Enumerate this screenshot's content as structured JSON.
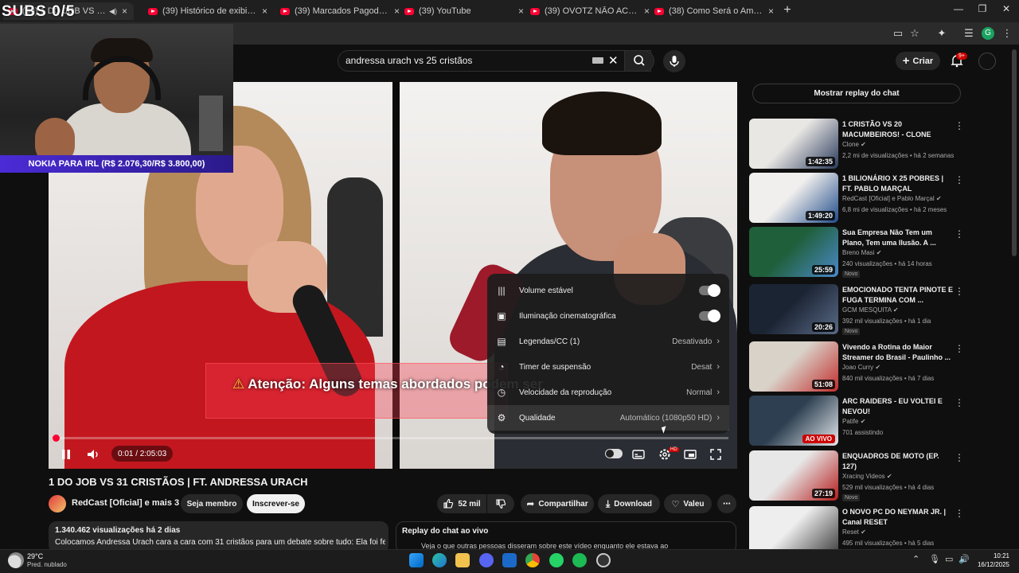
{
  "browser": {
    "tabs": [
      {
        "title": "(39) 1 DO JOB VS 31 CRISTÃ",
        "active": true
      },
      {
        "title": "(39) Histórico de exibição - You"
      },
      {
        "title": "(39) Marcados Pagode Gospel |"
      },
      {
        "title": "(39) YouTube"
      },
      {
        "title": "(39) OVOTZ NÃO ACREDITOU C"
      },
      {
        "title": "(38) Como Será o Amanhã | Ma"
      }
    ],
    "new_tab": "+",
    "close": "×",
    "minimize": "—",
    "maximize": "❐",
    "window_close": "✕"
  },
  "stream_overlay": {
    "subs_counter": "SUBS  0/5",
    "banner": "NOKIA PARA IRL (R$ 2.076,30/R$ 3.800,00)"
  },
  "youtube": {
    "search_value": "andressa urach vs 25 cristãos",
    "create_label": "Criar",
    "notifications_badge": "9+"
  },
  "player": {
    "warning_text": "Atenção: Alguns temas abordados podem ser",
    "time": "0:01 / 2:05:03",
    "progress_fraction": 0.001,
    "hd_badge": "HD",
    "settings": [
      {
        "icon": "volume-stable-icon",
        "label": "Volume estável",
        "type": "toggle",
        "on": true
      },
      {
        "icon": "ambient-mode-icon",
        "label": "Iluminação cinematográfica",
        "type": "toggle",
        "on": true
      },
      {
        "icon": "captions-icon",
        "label": "Legendas/CC (1)",
        "value": "Desativado"
      },
      {
        "icon": "sleep-timer-icon",
        "label": "Timer de suspensão",
        "value": "Desat"
      },
      {
        "icon": "playback-speed-icon",
        "label": "Velocidade da reprodução",
        "value": "Normal"
      },
      {
        "icon": "quality-icon",
        "label": "Qualidade",
        "value": "Automático (1080p50 HD)"
      }
    ]
  },
  "video": {
    "title": "1 DO JOB VS 31 CRISTÃOS | FT. ANDRESSA URACH",
    "channel": "RedCast [Oficial] e mais 3",
    "join_label": "Seja membro",
    "subscribe_label": "Inscrever-se",
    "likes": "52 mil",
    "share_label": "Compartilhar",
    "download_label": "Download",
    "thanks_label": "Valeu",
    "views_line": "1.340.462 visualizações  há 2 dias",
    "description": "Colocamos Andressa Urach cara a cara com 31 cristãos para um debate sobre tudo: Ela foi feita do",
    "chat_replay_title": "Replay do chat ao vivo",
    "chat_replay_text": "Veja o que outras pessoas disseram sobre este vídeo enquanto ele estava ao"
  },
  "sidebar": {
    "replay_chat_label": "Mostrar replay do chat",
    "recommendations": [
      {
        "title": "1 CRISTÃO VS 20 MACUMBEIROS! - CLONE",
        "channel": "Clone",
        "meta": "2,2 mi de visualizações • há 2 semanas",
        "duration": "1:42:35",
        "badge": "",
        "thumb_colors": [
          "#e9e7e4",
          "#2a3a5c"
        ]
      },
      {
        "title": "1 BILIONÁRIO X 25 POBRES | FT. PABLO MARÇAL",
        "channel": "RedCast [Oficial] e Pablo Marçal",
        "meta": "6,8 mi de visualizações • há 2 meses",
        "duration": "1:49:20",
        "badge": "",
        "thumb_colors": [
          "#f1efed",
          "#1f4b8a"
        ]
      },
      {
        "title": "Sua Empresa Não Tem um Plano, Tem uma Ilusão. A ...",
        "channel": "Breno Masi",
        "meta": "240 visualizações • há 14 horas",
        "duration": "25:59",
        "badge": "Novo",
        "thumb_colors": [
          "#1f5f3a",
          "#4b89c9"
        ]
      },
      {
        "title": "EMOCIONADO TENTA PINOTE E FUGA TERMINA COM ...",
        "channel": "GCM MESQUITA",
        "meta": "392 mil visualizações • há 1 dia",
        "duration": "20:26",
        "badge": "Novo",
        "thumb_colors": [
          "#1b2433",
          "#5a6b88"
        ]
      },
      {
        "title": "Vivendo a Rotina do Maior Streamer do Brasil - Paulinho ...",
        "channel": "Joao Curry",
        "meta": "840 mil visualizações • há 7 dias",
        "duration": "51:08",
        "badge": "",
        "thumb_colors": [
          "#d9d2c8",
          "#c22d2d"
        ]
      },
      {
        "title": "ARC RAIDERS - EU VOLTEI E NEVOU! ",
        "channel": "Patife",
        "meta": "701 assistindo",
        "duration": "",
        "live_label": "AO VIVO",
        "badge": "",
        "thumb_colors": [
          "#2d3f50",
          "#e4e9ee"
        ]
      },
      {
        "title": "ENQUADROS DE MOTO (EP. 127)",
        "channel": "Xracing Videos",
        "meta": "529 mil visualizações • há 4 dias",
        "duration": "27:19",
        "badge": "Novo",
        "thumb_colors": [
          "#e7e7e7",
          "#b51c1c"
        ]
      },
      {
        "title": "O NOVO PC DO NEYMAR JR. | Canal RESET",
        "channel": "Reset",
        "meta": "495 mil visualizações • há 5 dias",
        "duration": "",
        "badge": "",
        "thumb_colors": [
          "#eeeeee",
          "#3a3a3a"
        ]
      }
    ]
  },
  "taskbar": {
    "temperature": "29°C",
    "weather": "Pred. nublado",
    "time": "10:21",
    "date": "16/12/2025"
  }
}
